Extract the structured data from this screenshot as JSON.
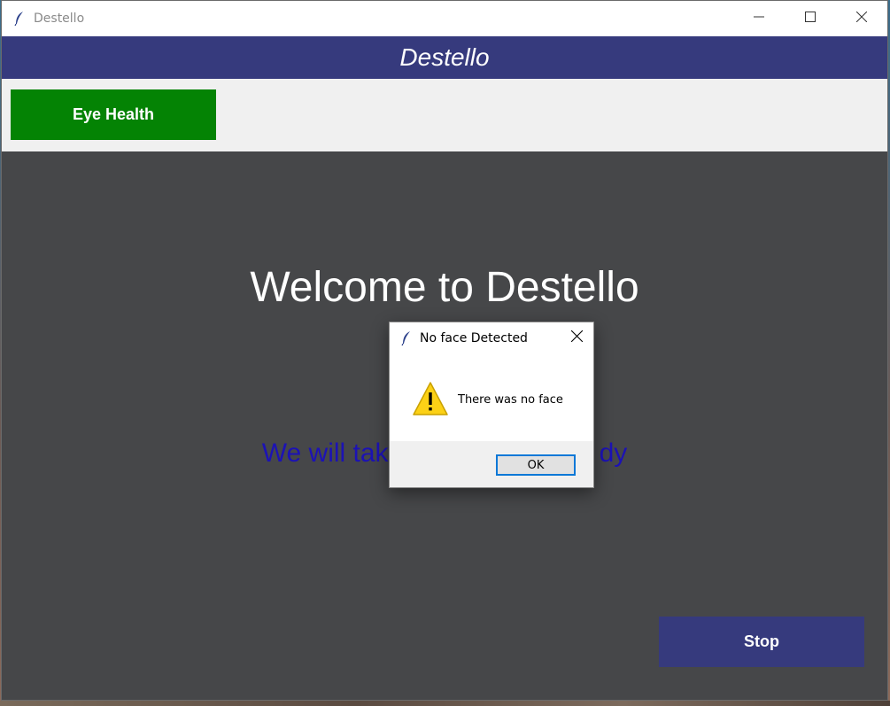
{
  "window": {
    "title": "Destello",
    "icon": "feather-icon",
    "controls": [
      "minimize-icon",
      "maximize-icon",
      "close-icon"
    ]
  },
  "header": {
    "title": "Destello",
    "background": "#363a7d"
  },
  "toolbar": {
    "eye_health_label": "Eye Health",
    "eye_health_color": "#048304"
  },
  "main": {
    "welcome_text": "Welcome to Destello",
    "tagline_visible": "We will tak",
    "tagline_visible_end": "dy",
    "stop_label": "Stop",
    "background": "#464749"
  },
  "dialog": {
    "title": "No face Detected",
    "icon": "feather-icon",
    "message": "There was no face",
    "warning_icon": "warning-icon",
    "ok_label": "OK"
  }
}
